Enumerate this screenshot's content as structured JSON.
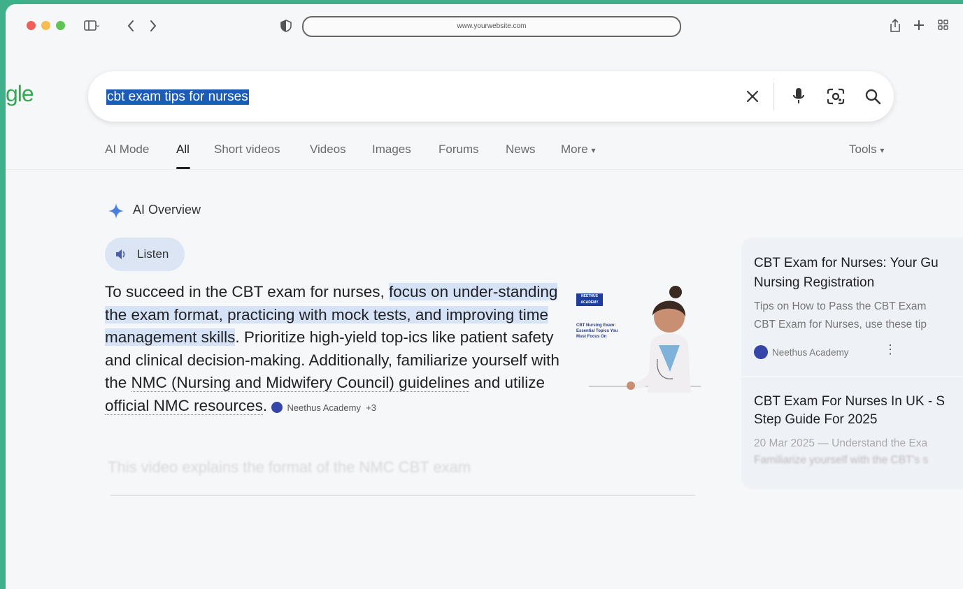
{
  "browser": {
    "url": "www.yourwebsite.com"
  },
  "google": {
    "logo_fragment": "gle",
    "query": "cbt exam tips for nurses",
    "tabs": [
      {
        "label": "AI Mode",
        "active": false
      },
      {
        "label": "All",
        "active": true
      },
      {
        "label": "Short videos",
        "active": false
      },
      {
        "label": "Videos",
        "active": false
      },
      {
        "label": "Images",
        "active": false
      },
      {
        "label": "Forums",
        "active": false
      },
      {
        "label": "News",
        "active": false
      },
      {
        "label": "More",
        "active": false
      }
    ],
    "tools_label": "Tools"
  },
  "ai_overview": {
    "heading": "AI Overview",
    "listen_label": "Listen",
    "p1": "To succeed in the CBT exam for nurses, ",
    "p1_highlight": "focus on under-standing the exam format, practicing with mock tests, and improving time management skills",
    "p2": ". Prioritize high-yield top-ics like patient safety and clinical decision-making. Additionally, familiarize yourself with the ",
    "link1": "NMC (Nursing and Midwifery Council) guidelines",
    "p3": " and utilize ",
    "link2": "official NMC resources",
    "p4": ".",
    "source": "Neethus Academy",
    "source_more": "+3",
    "faded_text": "This video explains the format of the NMC CBT exam",
    "thumb_badge": "NEETHUS ACADEMY",
    "thumb_caption": "CBT Nursing Exam: Essential Topics You Must Focus On"
  },
  "results": [
    {
      "title_1": "CBT Exam for Nurses: Your Gu",
      "title_2": "Nursing Registration",
      "snippet_1": "Tips on How to Pass the CBT Exam",
      "snippet_2": "CBT Exam for Nurses, use these tip",
      "source": "Neethus Academy"
    },
    {
      "title_1": "CBT Exam For Nurses In UK - S",
      "title_2": "Step Guide For 2025",
      "snippet_1": "20 Mar 2025 — Understand the Exa",
      "snippet_2": "Familiarize yourself with the CBT's s"
    }
  ],
  "colors": {
    "frame": "#3fb08a",
    "highlight": "#d6e3f6",
    "selection": "#1d5bb8",
    "source_dot": "#3645a8"
  }
}
